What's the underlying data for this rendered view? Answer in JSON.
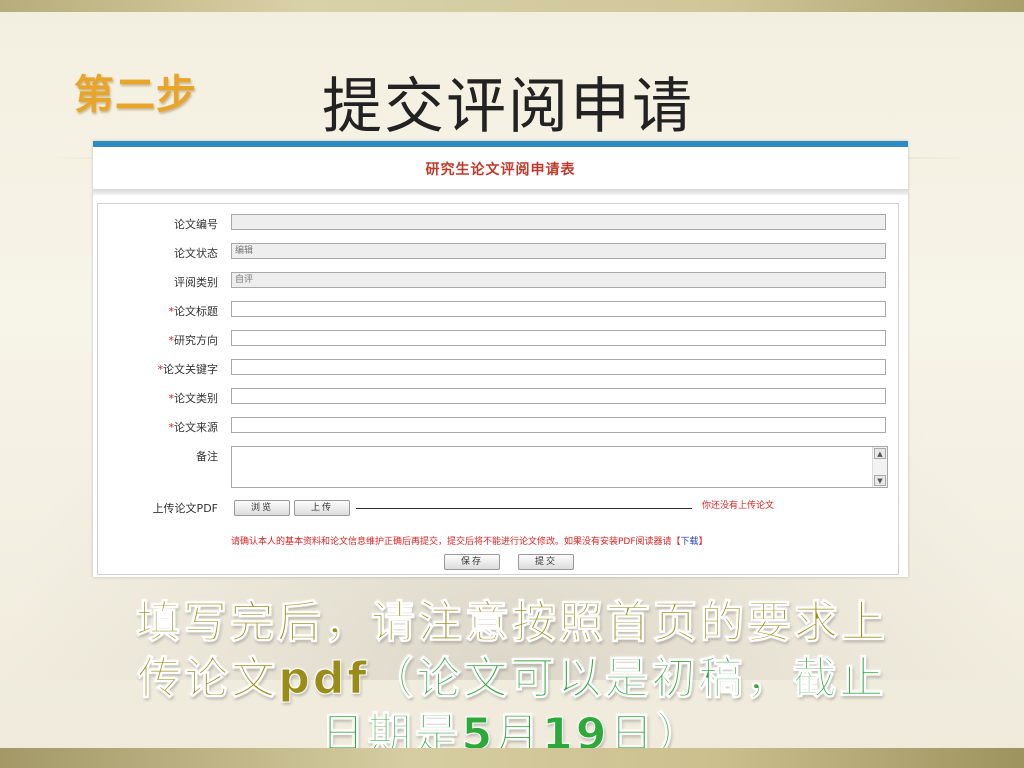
{
  "slide": {
    "step_label": "第二步",
    "title": "提交评阅申请"
  },
  "form": {
    "title": "研究生论文评阅申请表",
    "fields": [
      {
        "label": "论文编号",
        "required": false,
        "value": "",
        "readonly": true
      },
      {
        "label": "论文状态",
        "required": false,
        "value": "编辑",
        "readonly": true
      },
      {
        "label": "评阅类别",
        "required": false,
        "value": "自评",
        "readonly": true
      },
      {
        "label": "论文标题",
        "required": true,
        "value": "",
        "readonly": false
      },
      {
        "label": "研究方向",
        "required": true,
        "value": "",
        "readonly": false
      },
      {
        "label": "论文关键字",
        "required": true,
        "value": "",
        "readonly": false
      },
      {
        "label": "论文类别",
        "required": true,
        "value": "",
        "readonly": false
      },
      {
        "label": "论文来源",
        "required": true,
        "value": "",
        "readonly": false
      }
    ],
    "remark_label": "备注",
    "upload_label": "上传论文PDF",
    "browse_label": "浏览",
    "upload_button_label": "上传",
    "no_upload_text": "你还没有上传论文",
    "notice_text": "请确认本人的基本资料和论文信息维护正确后再提交，提交后将不能进行论文修改。如果没有安装PDF阅读器请【",
    "download_link": "下载",
    "notice_end": "】",
    "save_label": "保存",
    "submit_label": "提交"
  },
  "caption": {
    "line1": "填写完后，请注意按照首页的要求上",
    "line2_part1": "传论文pdf",
    "line2_part2": "（论文可以是初稿，截止",
    "line3": "日期是5月19日）"
  },
  "colors": {
    "step": "#e9a42a",
    "form_title": "#c0392b",
    "required_mark": "#e02020",
    "caption_olive": "#9a8d17",
    "caption_green": "#2fa83a",
    "header_bar": "#2b8cc4"
  }
}
